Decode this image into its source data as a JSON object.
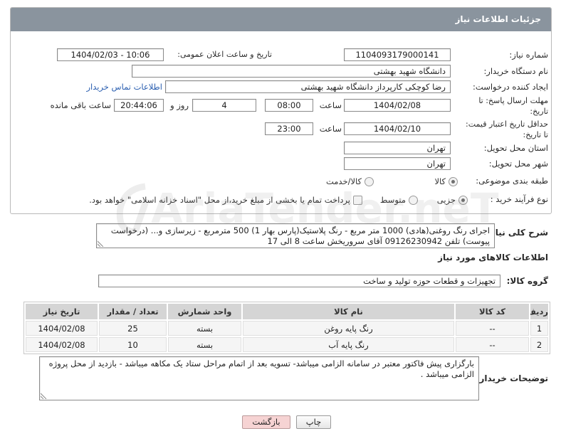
{
  "page": {
    "title": "جزئیات اطلاعات نیاز"
  },
  "watermark": "AriaTender.neT",
  "colors": {
    "header_bg": "#8a949e",
    "link": "#2b5fb0",
    "back_button_bg": "#f6d3d3",
    "table_header_bg": "#d5d5d5"
  },
  "need_number": {
    "label": "شماره نیاز:",
    "value": "1104093179000141"
  },
  "announce": {
    "label": "تاریخ و ساعت اعلان عمومی:",
    "value": "1404/02/03 - 10:06"
  },
  "buyer_org": {
    "label": "نام دستگاه خریدار:",
    "value": "دانشگاه شهید بهشتی"
  },
  "requester": {
    "label": "ایجاد کننده درخواست:",
    "value": "رضا کوچکی کارپرداز دانشگاه شهید بهشتی",
    "contact_link": "اطلاعات تماس خریدار"
  },
  "response_deadline": {
    "label_lines": [
      "مهلت ارسال پاسخ: تا",
      "تاریخ:"
    ],
    "date": "1404/02/08",
    "time_label": "ساعت",
    "time": "08:00",
    "days": "4",
    "days_label": "روز و",
    "remaining": "20:44:06",
    "remaining_label": "ساعت باقی مانده"
  },
  "price_validity": {
    "label_lines": [
      "حداقل تاریخ اعتبار قیمت:",
      "تا تاریخ:"
    ],
    "date": "1404/02/10",
    "time_label": "ساعت",
    "time": "23:00"
  },
  "province": {
    "label": "استان محل تحویل:",
    "value": "تهران"
  },
  "city": {
    "label": "شهر محل تحویل:",
    "value": "تهران"
  },
  "category": {
    "label": "طبقه بندی موضوعی:",
    "options": [
      {
        "label": "کالا",
        "checked": true
      },
      {
        "label": "کالا/خدمت",
        "checked": false
      }
    ]
  },
  "purchase_type": {
    "label": "نوع فرآیند خرید :",
    "options": [
      {
        "label": "جزیی",
        "checked": true
      },
      {
        "label": "متوسط",
        "checked": false
      }
    ],
    "treasury": {
      "label": "پرداخت تمام یا بخشی از مبلغ خرید،از محل \"اسناد خزانه اسلامی\" خواهد بود.",
      "checked": false
    }
  },
  "description": {
    "label": "شرح کلی نیاز:",
    "text": "اجرای رنگ روغنی(هادی) 1000 متر مربع - رنگ پلاستیک(پارس بهار 1) 500 مترمربع - زیرسازی و... (درخواست پیوست) تلفن 09126230942 آقای سروریخش ساعت 8 الی 17"
  },
  "goods": {
    "heading": "اطلاعات کالاهای مورد نیاز",
    "group_label": "گروه کالا:",
    "group_value": "تجهیزات و قطعات حوزه تولید و ساخت",
    "columns": [
      "ردیف",
      "کد کالا",
      "نام کالا",
      "واحد شمارش",
      "تعداد / مقدار",
      "تاریخ نیاز"
    ],
    "rows": [
      [
        "1",
        "--",
        "رنگ پایه روغن",
        "بسته",
        "25",
        "1404/02/08"
      ],
      [
        "2",
        "--",
        "رنگ پایه آب",
        "بسته",
        "10",
        "1404/02/08"
      ]
    ]
  },
  "buyer_notes": {
    "label": "توضیحات خریدار:",
    "text": "بارگزاری پیش فاکتور معتبر در سامانه الزامی میباشد- تسویه بعد از اتمام مراحل ستاد یک مکاهه میباشد - بازدید از محل پروژه الزامی میباشد ."
  },
  "buttons": {
    "print": "چاپ",
    "back": "بازگشت"
  }
}
